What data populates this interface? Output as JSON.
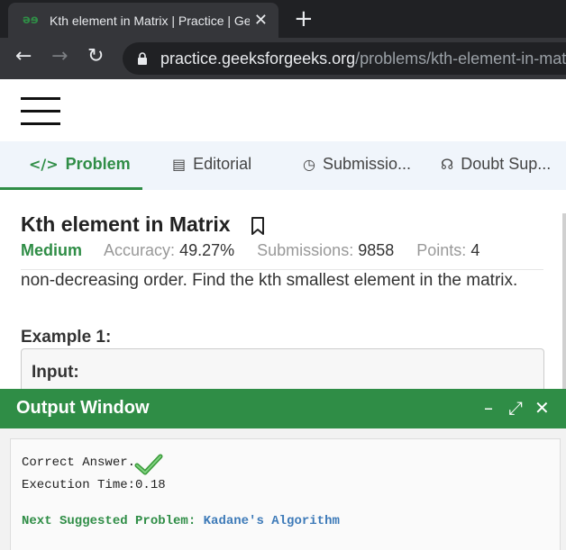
{
  "browser": {
    "tab_title": "Kth element in Matrix | Practice | GeeksforGeeks",
    "favicon_text": "əɘ",
    "url_host": "practice.geeksforgeeks.org",
    "url_path": "/problems/kth-element-in-matrix"
  },
  "tabs": [
    {
      "label": "Problem",
      "icon": "code-icon",
      "active": true
    },
    {
      "label": "Editorial",
      "icon": "document-icon",
      "active": false
    },
    {
      "label": "Submissio...",
      "icon": "clock-icon",
      "active": false
    },
    {
      "label": "Doubt Sup...",
      "icon": "headset-icon",
      "active": false
    }
  ],
  "problem": {
    "title": "Kth element in Matrix",
    "difficulty": "Medium",
    "accuracy_label": "Accuracy:",
    "accuracy": "49.27%",
    "submissions_label": "Submissions:",
    "submissions": "9858",
    "points_label": "Points:",
    "points": "4",
    "description": "non-decreasing order. Find the kth smallest element in the matrix.",
    "example_heading": "Example 1:",
    "input_label": "Input:"
  },
  "output_window": {
    "title": "Output Window",
    "result": "Correct Answer.",
    "execution_time": "Execution Time:0.18",
    "next_label": "Next Suggested Problem:",
    "next_problem": "Kadane's Algorithm"
  },
  "colors": {
    "brand_green": "#2f8d46",
    "link_blue": "#3d7ab8"
  }
}
